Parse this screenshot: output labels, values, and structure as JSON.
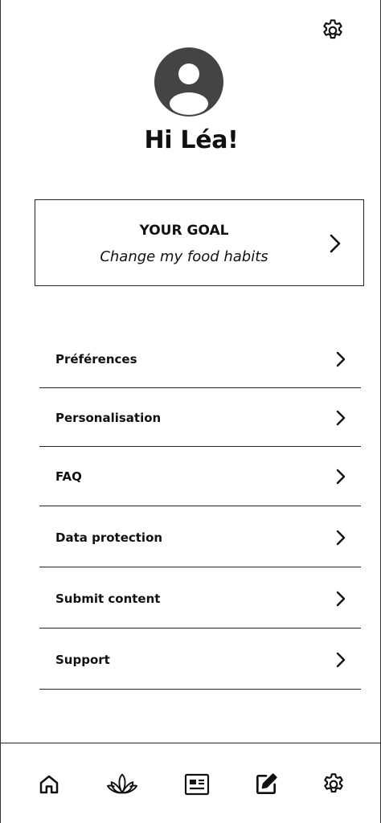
{
  "header": {
    "settings_icon": "gear-icon",
    "avatar_icon": "user-avatar-icon",
    "greeting": "Hi Léa!"
  },
  "goal": {
    "title": "YOUR GOAL",
    "text": "Change my food habits",
    "chevron_icon": "chevron-right-icon"
  },
  "menu": {
    "items": [
      {
        "label": "Préférences"
      },
      {
        "label": "Personalisation"
      },
      {
        "label": "FAQ"
      },
      {
        "label": "Data protection"
      },
      {
        "label": "Submit content"
      },
      {
        "label": "Support"
      }
    ]
  },
  "bottom_nav": {
    "items": [
      {
        "icon": "home-icon"
      },
      {
        "icon": "lotus-icon"
      },
      {
        "icon": "news-icon"
      },
      {
        "icon": "edit-icon"
      },
      {
        "icon": "gear-icon"
      }
    ]
  },
  "colors": {
    "text": "#111111",
    "avatar": "#444444",
    "border": "#222222",
    "background": "#ffffff"
  }
}
